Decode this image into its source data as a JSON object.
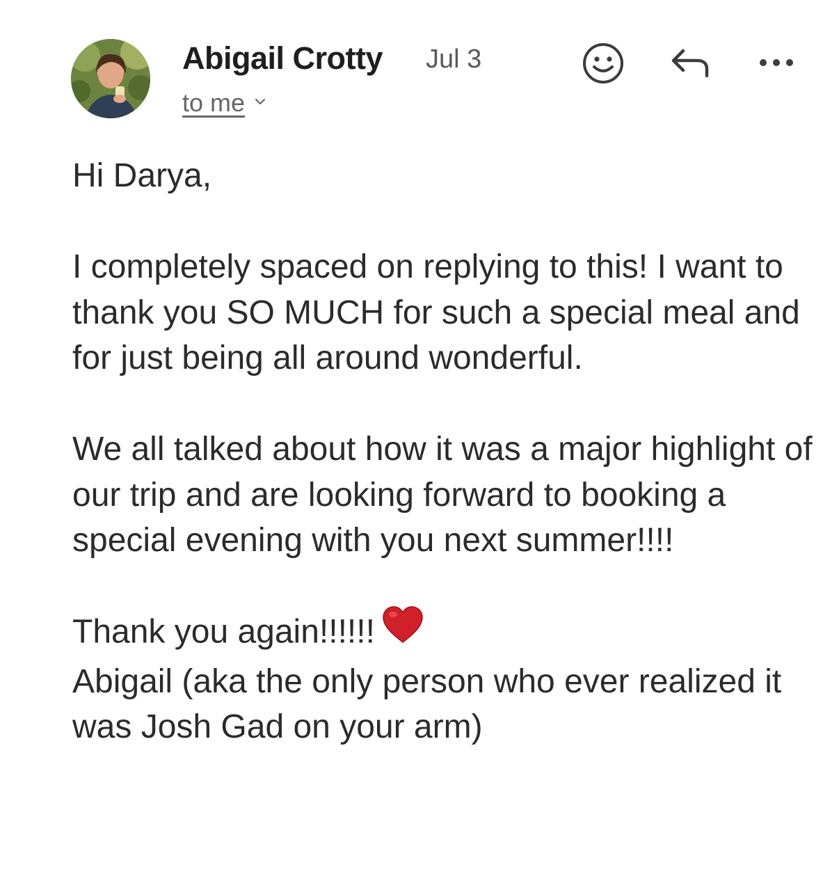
{
  "email": {
    "sender": {
      "name": "Abigail Crotty",
      "date": "Jul 3",
      "recipient_label": "to me"
    },
    "actions": {
      "emoji_icon": "smiley-face-icon",
      "reply_icon": "reply-arrow-icon",
      "more_icon": "more-options-icon"
    },
    "body": {
      "greeting": "Hi Darya,",
      "paragraph1": "I completely spaced on replying to this! I want to thank you SO MUCH for such a special meal and for just being all around wonderful.",
      "paragraph2": "We all talked about how it was a major highlight of our trip and are looking forward to booking a special evening with you next summer!!!!",
      "closing": "Thank you again!!!!!!",
      "signature": "Abigail (aka the only person who ever realized it was Josh Gad on your arm)"
    },
    "colors": {
      "text": "#2b2b2b",
      "secondary": "#5a5a5a",
      "heart": "#d0202a"
    }
  }
}
